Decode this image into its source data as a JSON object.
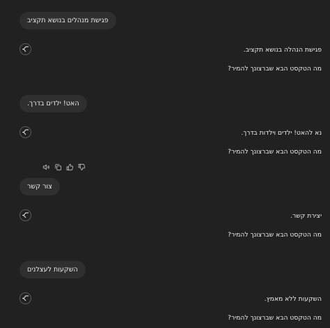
{
  "conversation": {
    "exchanges": [
      {
        "user_message": "פגישת מנהלים בנושא תקציב",
        "assistant_line1": "פגישת הנהלה בנושא תקציב.",
        "assistant_line2": "מה הטקסט הבא שברצונך להמיר?"
      },
      {
        "user_message": "האט! ילדים בדרך.",
        "assistant_line1": "נא להאט! ילדים וילדות בדרך.",
        "assistant_line2": "מה הטקסט הבא שברצונך להמיר?"
      },
      {
        "user_message": "צור קשר",
        "assistant_line1": "יצירת קשר.",
        "assistant_line2": "מה הטקסט הבא שברצונך להמיר?"
      },
      {
        "user_message": "השקעות לעצלנים",
        "assistant_line1": "השקעות ללא מאמץ.",
        "assistant_line2": "מה הטקסט הבא שברצונך להמיר?"
      }
    ],
    "avatar_icon": "assistant-logo-icon",
    "message_actions": [
      {
        "icon": "read-aloud-icon"
      },
      {
        "icon": "copy-icon"
      },
      {
        "icon": "thumbs-up-icon"
      },
      {
        "icon": "thumbs-down-icon"
      }
    ]
  },
  "colors": {
    "background": "#212121",
    "bubble": "#2f2f2f",
    "text": "#ececec",
    "icon": "#b4b4b4"
  }
}
